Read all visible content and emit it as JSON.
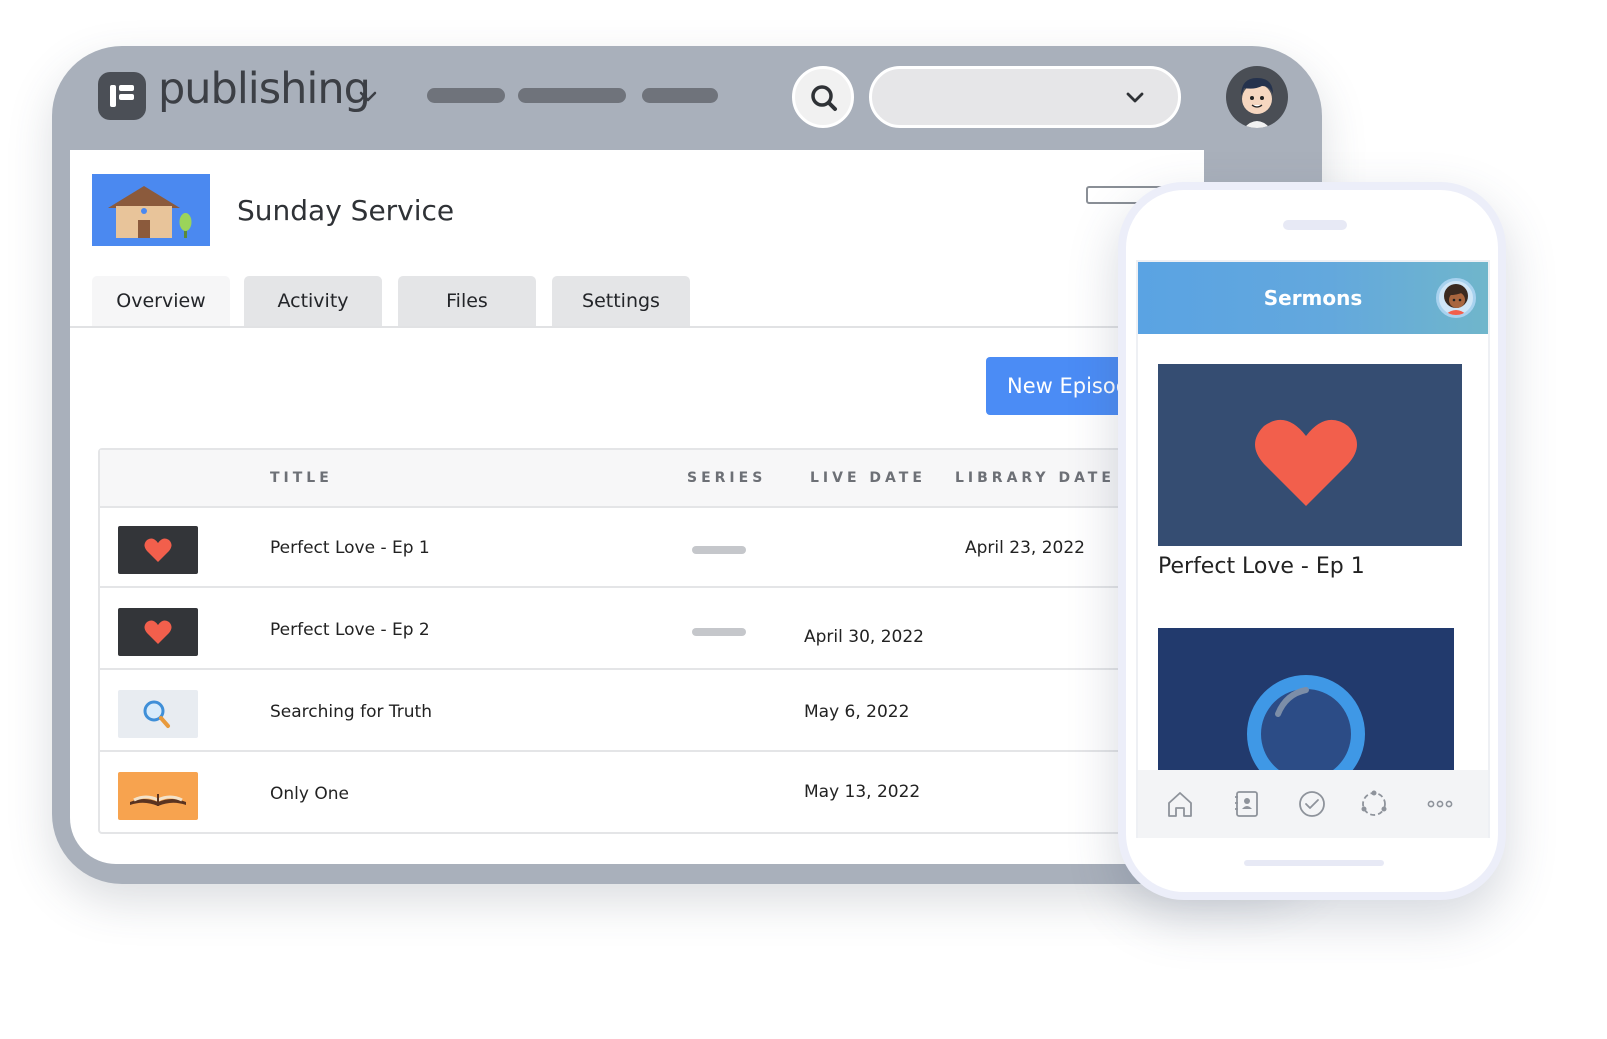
{
  "app": {
    "name": "publishing"
  },
  "show": {
    "title": "Sunday Service",
    "new_episode_label": "New Episode"
  },
  "tabs": [
    {
      "label": "Overview",
      "active": true
    },
    {
      "label": "Activity"
    },
    {
      "label": "Files"
    },
    {
      "label": "Settings"
    }
  ],
  "table": {
    "headers": {
      "title": "TITLE",
      "series": "SERIES",
      "live_date": "LIVE DATE",
      "library_date": "LIBRARY DATE"
    },
    "rows": [
      {
        "title": "Perfect Love - Ep 1",
        "thumb": "heart-icon",
        "has_series": true,
        "live_date": "",
        "library_date": "April 23, 2022"
      },
      {
        "title": "Perfect Love - Ep 2",
        "thumb": "heart-icon",
        "has_series": true,
        "live_date": "April 30, 2022",
        "library_date": ""
      },
      {
        "title": "Searching for Truth",
        "thumb": "magnifier-icon",
        "has_series": false,
        "live_date": "May 6, 2022",
        "library_date": ""
      },
      {
        "title": "Only One",
        "thumb": "open-book-icon",
        "has_series": false,
        "live_date": "May 13, 2022",
        "library_date": ""
      }
    ]
  },
  "phone": {
    "header_title": "Sermons",
    "card_title": "Perfect Love - Ep 1",
    "tabbar": [
      "home-icon",
      "contacts-icon",
      "check-circle-icon",
      "groups-icon",
      "more-icon"
    ]
  },
  "colors": {
    "accent": "#4b8cf5",
    "window_frame": "#a9b0bb",
    "heart": "#f25f4c",
    "card_navy": "#354d72"
  }
}
